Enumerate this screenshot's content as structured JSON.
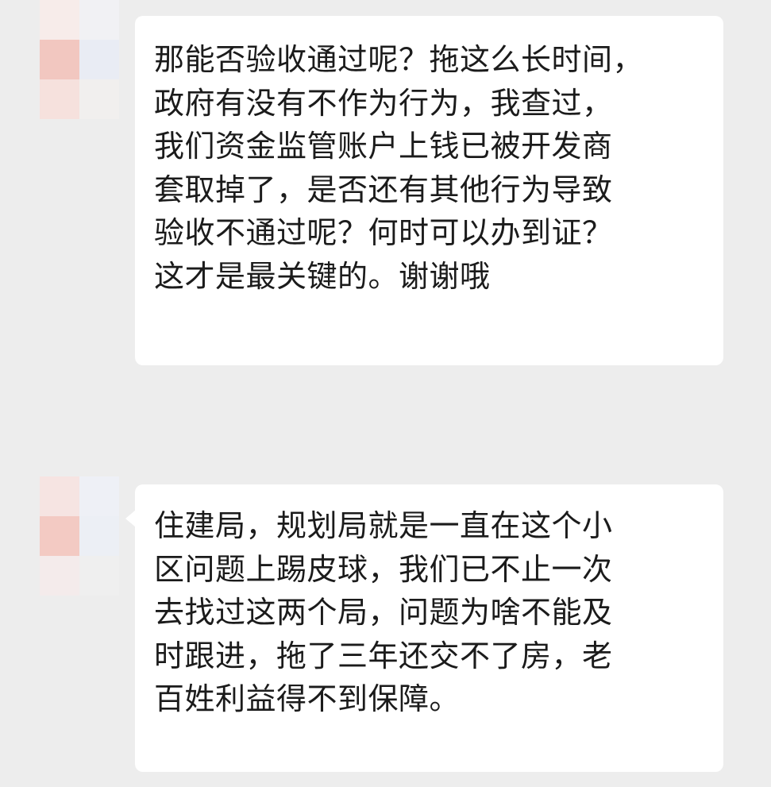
{
  "chat": {
    "messages": [
      {
        "sender": "incoming",
        "avatar_mosaic_colors": [
          "#f7ecea",
          "#f1f1f4",
          "#f2c7c0",
          "#e9ecf4",
          "#f6e1dd",
          "#f1efee"
        ],
        "text": "那能否验收通过呢？拖这么长时间，\n政府有没有不作为行为，我查过，\n我们资金监管账户上钱已被开发商\n套取掉了，是否还有其他行为导致\n验收不通过呢？何时可以办到证？\n这才是最关键的。谢谢哦"
      },
      {
        "sender": "incoming",
        "avatar_mosaic_colors": [
          "#f6e4e2",
          "#eef0f6",
          "#f3cac3",
          "#eceff5",
          "#f4ebeb",
          "#efefef"
        ],
        "text": "住建局，规划局就是一直在这个小\n区问题上踢皮球，我们已不止一次\n去找过这两个局，问题为啥不能及\n时跟进，拖了三年还交不了房，老\n百姓利益得不到保障。"
      }
    ]
  },
  "colors": {
    "background": "#ededed",
    "bubble": "#ffffff",
    "text": "#1b1b1b"
  }
}
